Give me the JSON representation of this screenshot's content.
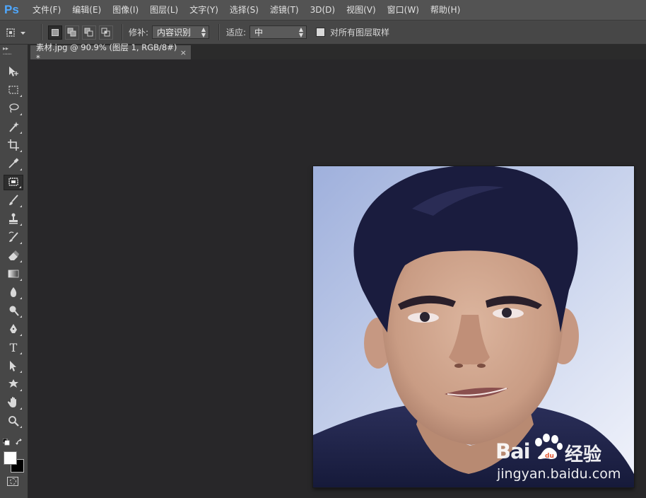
{
  "app": {
    "logo": "Ps"
  },
  "menu": [
    "文件(F)",
    "编辑(E)",
    "图像(I)",
    "图层(L)",
    "文字(Y)",
    "选择(S)",
    "滤镜(T)",
    "3D(D)",
    "视图(V)",
    "窗口(W)",
    "帮助(H)"
  ],
  "options": {
    "tool_icon": "patch-tool-icon",
    "patch_label": "修补:",
    "patch_value": "内容识别",
    "adapt_label": "适应:",
    "adapt_value": "中",
    "sample_all_label": "对所有图层取样",
    "sample_all_checked": false
  },
  "document": {
    "tab_title": "素材.jpg @ 90.9% (图层 1, RGB/8#) *",
    "close_symbol": "×"
  },
  "watermark": {
    "logo_text": "Bai",
    "brand_text": "经验",
    "url": "jingyan.baidu.com"
  },
  "toolbox": {
    "tools": [
      "move-tool-icon",
      "marquee-tool-icon",
      "lasso-tool-icon",
      "magic-wand-tool-icon",
      "crop-tool-icon",
      "eyedropper-tool-icon",
      "patch-tool-icon",
      "brush-tool-icon",
      "clone-stamp-tool-icon",
      "history-brush-tool-icon",
      "eraser-tool-icon",
      "gradient-tool-icon",
      "blur-tool-icon",
      "dodge-tool-icon",
      "pen-tool-icon",
      "type-tool-icon",
      "path-selection-tool-icon",
      "custom-shape-tool-icon",
      "hand-tool-icon",
      "zoom-tool-icon"
    ],
    "active_tool": "patch-tool-icon",
    "type_glyph": "T",
    "foreground_color": "#ffffff",
    "background_color": "#000000"
  },
  "colors": {
    "menubar": "#535353",
    "panel": "#474747",
    "canvas": "#282729",
    "accent": "#4fa8ff"
  }
}
